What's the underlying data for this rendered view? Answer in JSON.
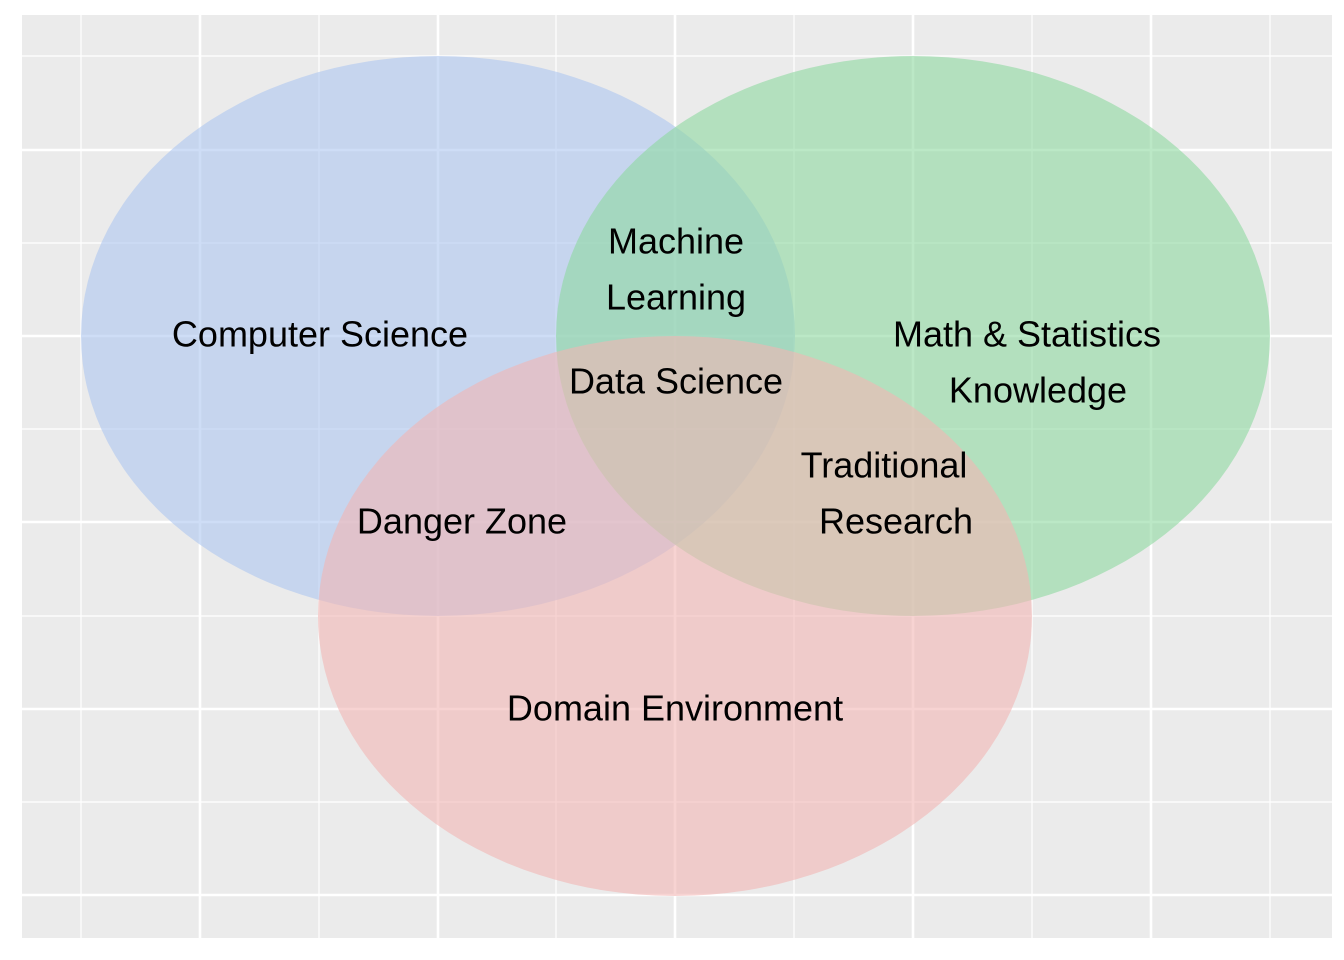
{
  "colors": {
    "panel_background": "#ebebeb",
    "gridline": "#ffffff",
    "computer_science": "#aec7f0",
    "math_statistics": "#8ed8a0",
    "domain_environment": "#f2b6b4"
  },
  "circles": [
    {
      "id": "computer_science",
      "label_lines": [
        "Computer Science"
      ]
    },
    {
      "id": "math_statistics",
      "label_lines": [
        "Math & Statistics",
        "Knowledge"
      ]
    },
    {
      "id": "domain_environment",
      "label_lines": [
        "Domain Environment"
      ]
    }
  ],
  "intersections": [
    {
      "id": "machine_learning",
      "label_lines": [
        "Machine",
        "Learning"
      ]
    },
    {
      "id": "danger_zone",
      "label_lines": [
        "Danger Zone"
      ]
    },
    {
      "id": "traditional_research",
      "label_lines": [
        "Traditional",
        "Research"
      ]
    },
    {
      "id": "data_science",
      "label_lines": [
        "Data Science"
      ]
    }
  ]
}
